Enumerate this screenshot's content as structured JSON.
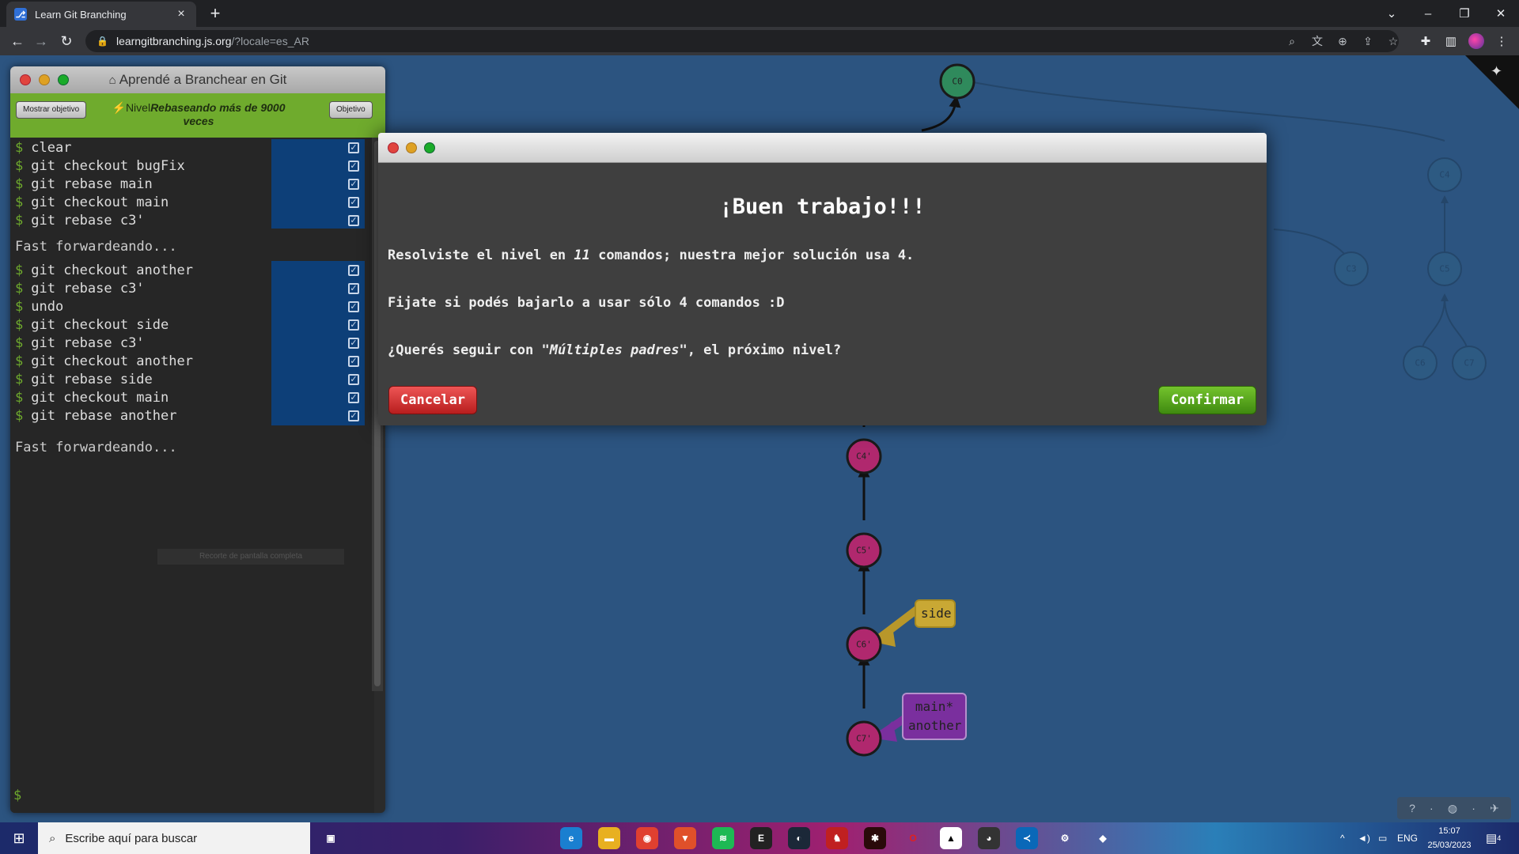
{
  "browser": {
    "tab_title": "Learn Git Branching",
    "tab_favicon": "git-logo-icon",
    "url_host": "learngitbranching.js.org",
    "url_path": "/?locale=es_AR"
  },
  "terminal": {
    "title": "Aprendé a Branchear en Git",
    "show_goal_label": "Mostrar objetivo",
    "level_prefix": "Nivel",
    "level_name": "Rebaseando más de 9000 veces",
    "objective_label": "Objetivo",
    "commands_group1": [
      "clear",
      "git checkout bugFix",
      "git rebase main",
      "git checkout main",
      "git rebase c3'"
    ],
    "output1": "Fast forwardeando...",
    "commands_group2": [
      "git checkout another",
      "git rebase c3'",
      "undo",
      "git checkout side",
      "git rebase c3'",
      "git checkout another",
      "git rebase side",
      "git checkout main",
      "git rebase another"
    ],
    "output2": "Fast forwardeando...",
    "fullscreen_label": "Recorte de pantalla completa",
    "prompt": "$"
  },
  "modal": {
    "heading": "¡Buen trabajo!!!",
    "line1_pre": "Resolviste el nivel en ",
    "line1_count": "11",
    "line1_post": " comandos; nuestra mejor solución usa 4.",
    "line2": "Fijate si podés bajarlo a usar sólo 4 comandos :D",
    "line3_pre": "¿Querés seguir con ",
    "line3_level": "\"Múltiples padres\"",
    "line3_post": ", el próximo nivel?",
    "cancel_label": "Cancelar",
    "confirm_label": "Confirmar"
  },
  "graph": {
    "nodes": {
      "c0": "C0",
      "c4p": "C4'",
      "c5p": "C5'",
      "c6p": "C6'",
      "c7p": "C7'",
      "c3": "C3",
      "c4": "C4",
      "c5": "C5",
      "c6": "C6",
      "c7": "C7"
    },
    "branches": {
      "side": "side",
      "main_another_1": "main*",
      "main_another_2": "another"
    }
  },
  "taskbar": {
    "search_placeholder": "Escribe aquí para buscar",
    "lang": "ENG",
    "time": "15:07",
    "date": "25/03/2023",
    "notifications": "4"
  },
  "colors": {
    "page_bg": "#2c5480",
    "commit_green": "#2f8a5c",
    "commit_magenta": "#b0286e",
    "side_branch": "#c9a834",
    "main_branch": "#7a2f9e",
    "level_bar": "#6fab2d"
  }
}
